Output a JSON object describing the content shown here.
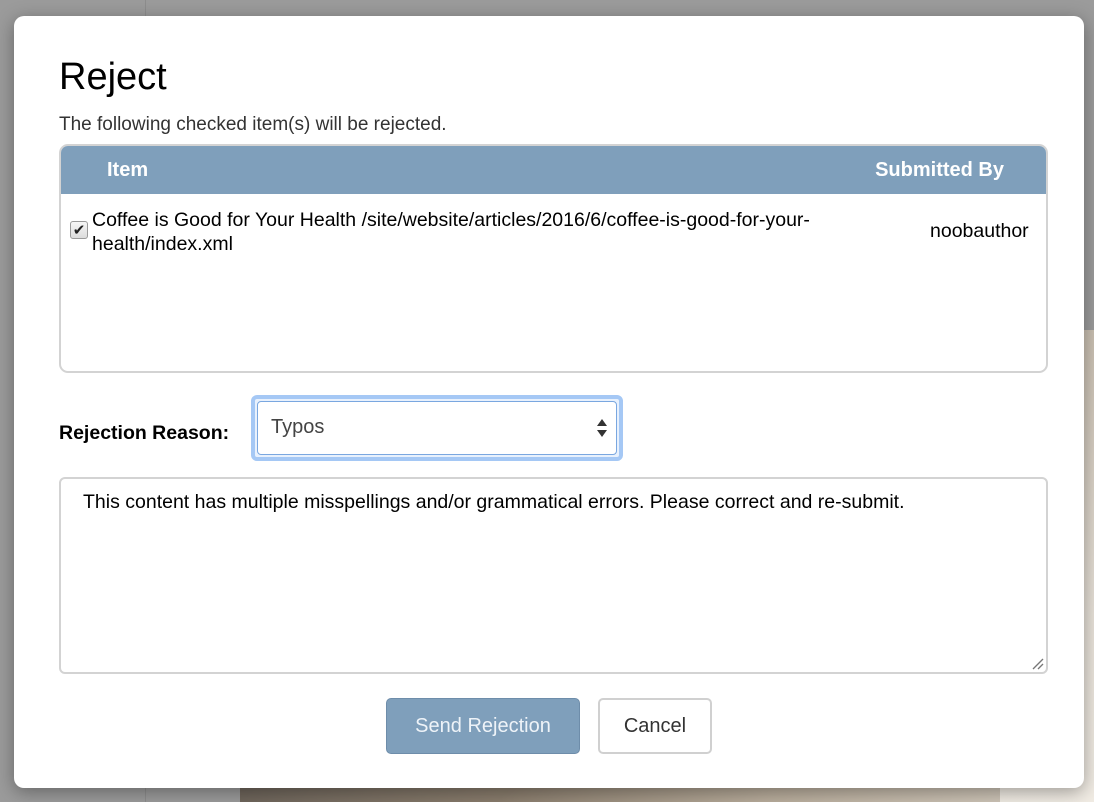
{
  "dialog": {
    "title": "Reject",
    "subtitle": "The following checked item(s) will be rejected."
  },
  "table": {
    "headers": {
      "item": "Item",
      "submitted_by": "Submitted By"
    },
    "rows": [
      {
        "checked": true,
        "item": "Coffee is Good for Your Health /site/website/articles/2016/6/coffee-is-good-for-your-health/index.xml",
        "submitted_by": "noobauthor"
      }
    ]
  },
  "rejection": {
    "label": "Rejection Reason:",
    "selected_reason": "Typos",
    "message": "This content has multiple misspellings and/or grammatical errors. Please correct and re-submit."
  },
  "buttons": {
    "send": "Send Rejection",
    "cancel": "Cancel"
  },
  "colors": {
    "header_bg": "#7f9fbb",
    "primary_button": "#7f9fbb",
    "focus_ring": "#a5c8f5"
  },
  "icons": {
    "checkbox": "checkmark-icon",
    "select": "select-arrows-icon",
    "textarea_resize": "resize-grip-icon"
  }
}
